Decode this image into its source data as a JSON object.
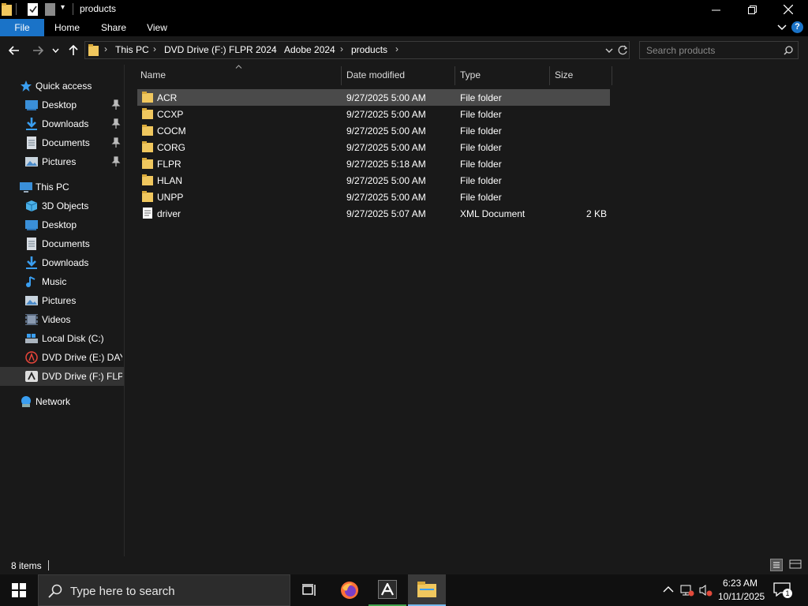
{
  "window": {
    "title": "products",
    "controls": {
      "minimize_icon": "minimize-icon",
      "maximize_icon": "restore-icon",
      "close_icon": "close-icon"
    }
  },
  "ribbon": {
    "tabs": [
      {
        "label": "File",
        "active": true
      },
      {
        "label": "Home"
      },
      {
        "label": "Share"
      },
      {
        "label": "View"
      }
    ]
  },
  "address": {
    "breadcrumbs": [
      "This PC",
      "DVD Drive (F:) FLPR 2024",
      "Adobe 2024",
      "products"
    ],
    "search_placeholder": "Search products"
  },
  "navpane": {
    "quick_access": {
      "label": "Quick access",
      "items": [
        {
          "label": "Desktop",
          "icon": "desktop-icon",
          "pinned": true
        },
        {
          "label": "Downloads",
          "icon": "downloads-icon",
          "pinned": true
        },
        {
          "label": "Documents",
          "icon": "documents-icon",
          "pinned": true
        },
        {
          "label": "Pictures",
          "icon": "pictures-icon",
          "pinned": true
        }
      ]
    },
    "this_pc": {
      "label": "This PC",
      "items": [
        {
          "label": "3D Objects",
          "icon": "3d-objects-icon"
        },
        {
          "label": "Desktop",
          "icon": "desktop-icon"
        },
        {
          "label": "Documents",
          "icon": "documents-icon"
        },
        {
          "label": "Downloads",
          "icon": "downloads-icon"
        },
        {
          "label": "Music",
          "icon": "music-icon"
        },
        {
          "label": "Pictures",
          "icon": "pictures-icon"
        },
        {
          "label": "Videos",
          "icon": "videos-icon"
        },
        {
          "label": "Local Disk (C:)",
          "icon": "local-disk-icon"
        },
        {
          "label": "DVD Drive (E:) DAY_",
          "icon": "dvd-drive-icon"
        },
        {
          "label": "DVD Drive (F:) FLPR",
          "icon": "dvd-drive-icon",
          "selected": true
        }
      ]
    },
    "network": {
      "label": "Network",
      "icon": "network-icon"
    }
  },
  "filelist": {
    "columns": [
      "Name",
      "Date modified",
      "Type",
      "Size"
    ],
    "rows": [
      {
        "name": "ACR",
        "date": "9/27/2025 5:00 AM",
        "type": "File folder",
        "size": "",
        "icon": "folder-icon",
        "selected": true
      },
      {
        "name": "CCXP",
        "date": "9/27/2025 5:00 AM",
        "type": "File folder",
        "size": "",
        "icon": "folder-icon"
      },
      {
        "name": "COCM",
        "date": "9/27/2025 5:00 AM",
        "type": "File folder",
        "size": "",
        "icon": "folder-icon"
      },
      {
        "name": "CORG",
        "date": "9/27/2025 5:00 AM",
        "type": "File folder",
        "size": "",
        "icon": "folder-icon"
      },
      {
        "name": "FLPR",
        "date": "9/27/2025 5:18 AM",
        "type": "File folder",
        "size": "",
        "icon": "folder-icon"
      },
      {
        "name": "HLAN",
        "date": "9/27/2025 5:00 AM",
        "type": "File folder",
        "size": "",
        "icon": "folder-icon"
      },
      {
        "name": "UNPP",
        "date": "9/27/2025 5:00 AM",
        "type": "File folder",
        "size": "",
        "icon": "folder-icon"
      },
      {
        "name": "driver",
        "date": "9/27/2025 5:07 AM",
        "type": "XML Document",
        "size": "2 KB",
        "icon": "xml-file-icon"
      }
    ]
  },
  "statusbar": {
    "item_count": "8 items"
  },
  "taskbar": {
    "search_placeholder": "Type here to search",
    "clock_time": "6:23 AM",
    "clock_date": "10/11/2025",
    "notification_count": "1"
  },
  "colors": {
    "accent": "#1a73c8",
    "folder": "#f0c75e",
    "background": "#191919",
    "selected_row": "#4a4a4a"
  }
}
